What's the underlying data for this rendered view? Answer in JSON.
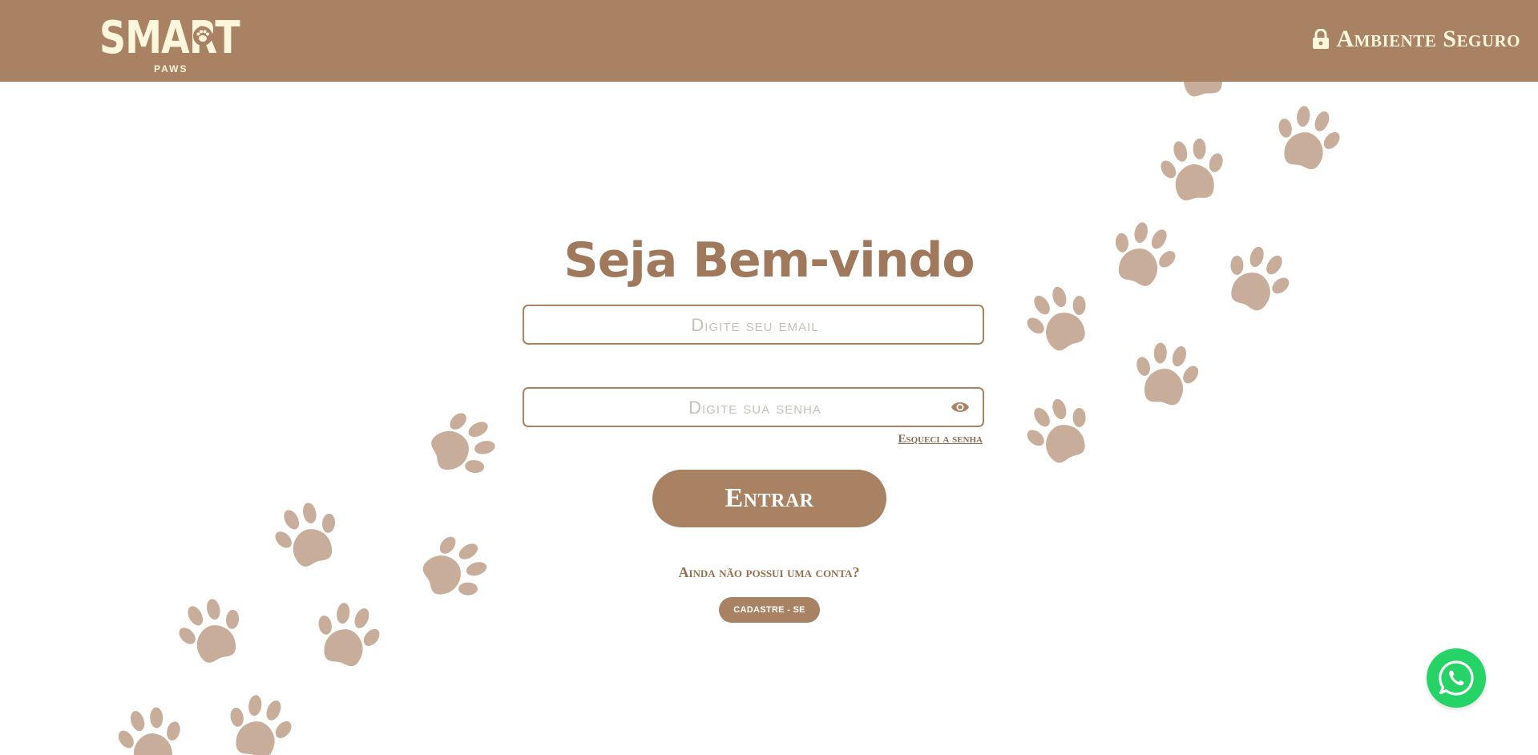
{
  "header": {
    "logo_text": "SMART",
    "logo_subtext": "PAWS",
    "secure_label": "Ambiente Seguro"
  },
  "login": {
    "title": "Seja Bem-vindo",
    "email_placeholder": "Digite seu email",
    "email_value": "",
    "password_placeholder": "Digite sua senha",
    "password_value": "",
    "forgot_label": "Esqueci a senha",
    "submit_label": "Entrar",
    "no_account_text": "Ainda não possui uma conta?",
    "signup_label": "CADASTRE - SE"
  },
  "icons": {
    "lock": "lock-icon",
    "eye": "eye-icon",
    "whatsapp": "whatsapp-icon",
    "paw": "paw-print-icon"
  },
  "colors": {
    "brand": "#a98163",
    "logo_cream": "#fbf6dc",
    "paw": "#c9ad9b",
    "whatsapp": "#26d366"
  }
}
